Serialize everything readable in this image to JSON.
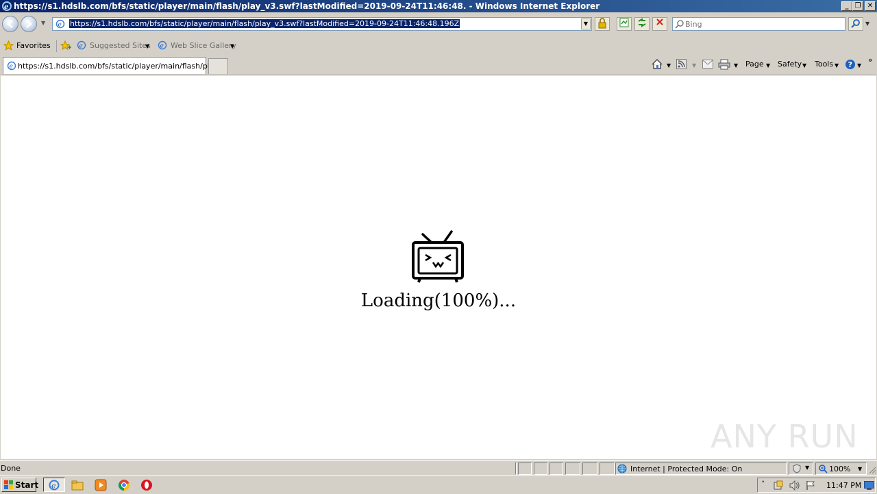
{
  "window": {
    "title": "https://s1.hdslb.com/bfs/static/player/main/flash/play_v3.swf?lastModified=2019-09-24T11:46:48. - Windows Internet Explorer",
    "minimize": "_",
    "restore": "❐",
    "close": "✕"
  },
  "nav": {
    "address": "https://s1.hdslb.com/bfs/static/player/main/flash/play_v3.swf?lastModified=2019-09-24T11:46:48.196Z",
    "search_placeholder": "Bing"
  },
  "favorites": {
    "favorites_label": "Favorites",
    "suggested_sites": "Suggested Sites",
    "web_slice_gallery": "Web Slice Gallery"
  },
  "tabs": {
    "active_title": "https://s1.hdslb.com/bfs/static/player/main/flash/pla..."
  },
  "commandbar": {
    "page": "Page",
    "safety": "Safety",
    "tools": "Tools"
  },
  "content": {
    "loading_text": "Loading(100%)...",
    "watermark": "ANY RUN"
  },
  "status": {
    "text": "Done",
    "zone": "Internet | Protected Mode: On",
    "zoom": "100%"
  },
  "taskbar": {
    "start_label": "Start",
    "clock": "11:47 PM"
  },
  "colors": {
    "titlebar_start": "#0a246a",
    "titlebar_end": "#3a6ea5",
    "chrome": "#d4d0c8",
    "selection": "#0a246a"
  }
}
